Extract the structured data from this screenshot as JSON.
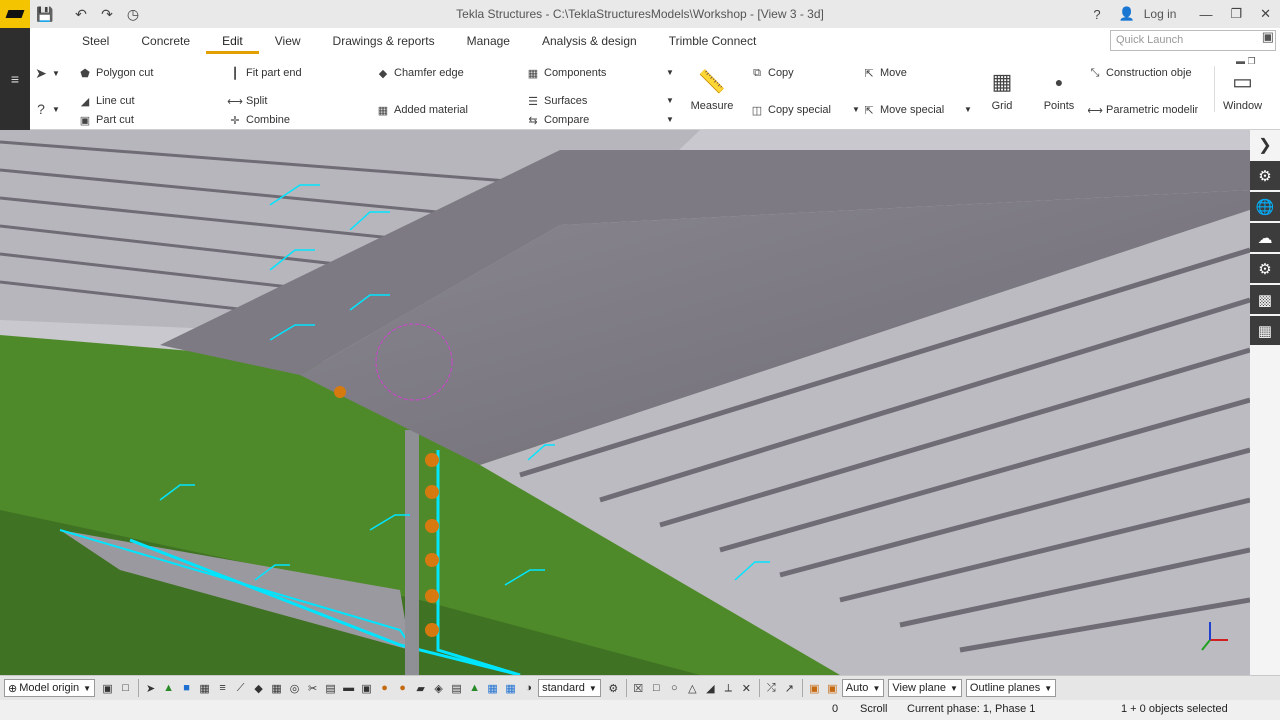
{
  "window": {
    "title": "Tekla Structures - C:\\TeklaStructuresModels\\Workshop - [View 3 - 3d]",
    "login": "Log in",
    "help_icon": "?",
    "min_icon": "—",
    "restore_icon": "❐",
    "close_icon": "✕"
  },
  "tabs": [
    {
      "label": "Steel"
    },
    {
      "label": "Concrete"
    },
    {
      "label": "Edit",
      "active": true
    },
    {
      "label": "View"
    },
    {
      "label": "Drawings & reports"
    },
    {
      "label": "Manage"
    },
    {
      "label": "Analysis & design"
    },
    {
      "label": "Trimble Connect"
    }
  ],
  "quick_launch": {
    "placeholder": "Quick Launch"
  },
  "ribbon": {
    "polygon_cut": "Polygon cut",
    "line_cut": "Line cut",
    "part_cut": "Part cut",
    "fit_part_end": "Fit part end",
    "split": "Split",
    "combine": "Combine",
    "chamfer_edge": "Chamfer edge",
    "added_material": "Added material",
    "components": "Components",
    "surfaces": "Surfaces",
    "compare": "Compare",
    "measure": "Measure",
    "copy": "Copy",
    "copy_special": "Copy special",
    "move": "Move",
    "move_special": "Move special",
    "grid": "Grid",
    "points": "Points",
    "construction_objects": "Construction obje",
    "parametric_modeling": "Parametric modelin",
    "window": "Window"
  },
  "bottom_toolbar": {
    "model_origin": "Model origin",
    "standard": "standard",
    "auto": "Auto",
    "view_plane": "View plane",
    "outline_planes": "Outline planes"
  },
  "status": {
    "value": "0",
    "scroll": "Scroll",
    "phase": "Current phase: 1, Phase 1",
    "selection": "1 + 0 objects selected"
  },
  "colors": {
    "accent": "#e2a000",
    "logo": "#f5c400",
    "steel_green": "#4f8a2a",
    "deck_grey": "#7a7780",
    "selection_cyan": "#00e5ff",
    "bolt_orange": "#d67a10"
  }
}
